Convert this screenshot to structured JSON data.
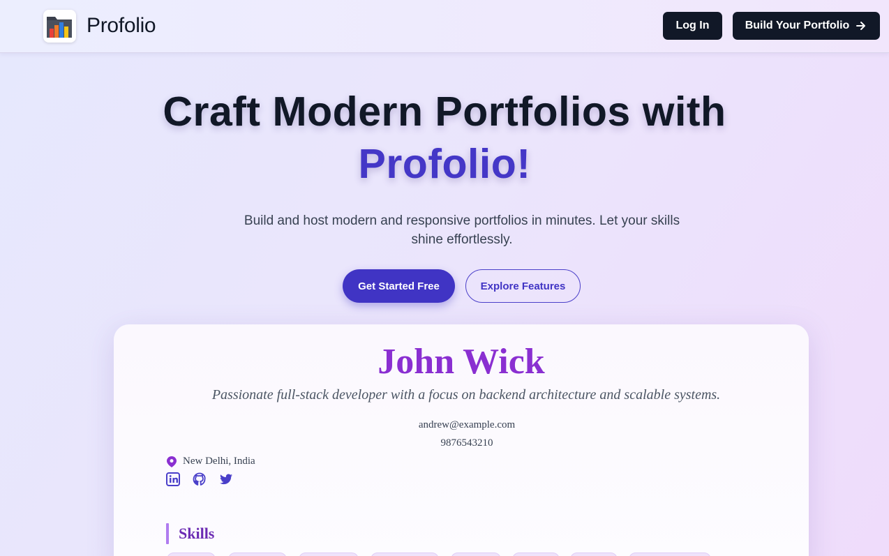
{
  "nav": {
    "brand": "Profolio",
    "login_label": "Log In",
    "build_label": "Build Your Portfolio",
    "logo_icon": "bar-chart-folder-icon",
    "arrow_icon": "arrow-right-icon"
  },
  "hero": {
    "title_line1": "Craft Modern Portfolios with",
    "title_line2": "Profolio!",
    "subtitle": "Build and host modern and responsive portfolios in minutes. Let your skills shine effortlessly.",
    "primary_cta": "Get Started Free",
    "secondary_cta": "Explore Features"
  },
  "preview": {
    "name": "John Wick",
    "tagline": "Passionate full-stack developer with a focus on backend architecture and scalable systems.",
    "email": "andrew@example.com",
    "phone": "9876543210",
    "location": "New Delhi, India",
    "social_icons": [
      "linkedin-icon",
      "github-icon",
      "twitter-icon"
    ],
    "skills_heading": "Skills"
  },
  "colors": {
    "accent": "#4034c4",
    "dark": "#111827",
    "name_purple": "#8a2fd1",
    "skills_purple": "#6b2bb3"
  }
}
